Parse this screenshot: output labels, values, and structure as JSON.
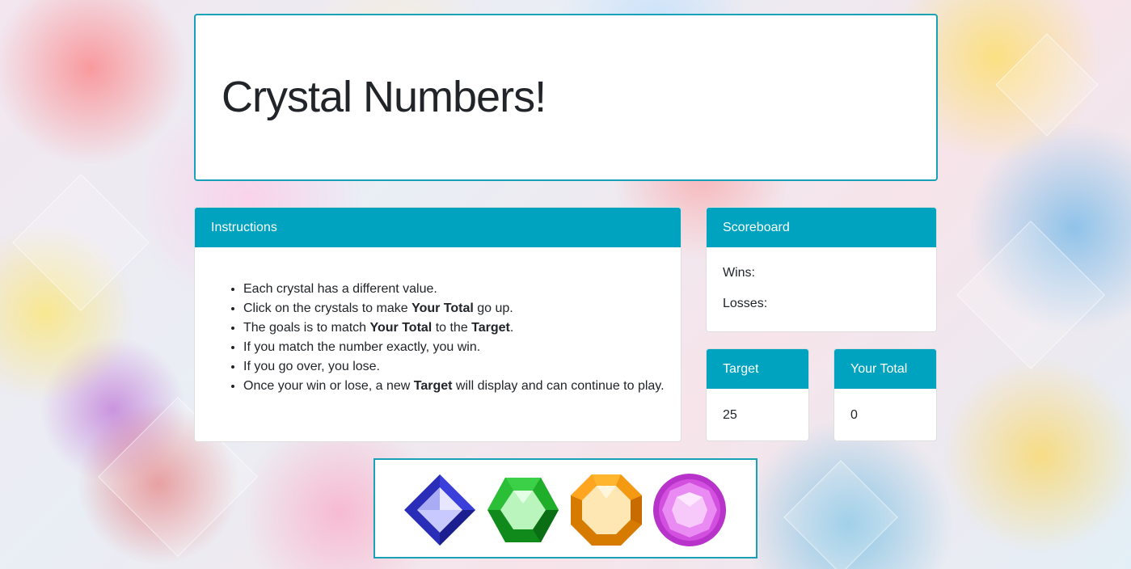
{
  "title": "Crystal Numbers!",
  "instructions": {
    "header": "Instructions",
    "items": [
      {
        "parts": [
          {
            "t": "Each crystal has a different value.",
            "b": false
          }
        ]
      },
      {
        "parts": [
          {
            "t": "Click on the crystals to make ",
            "b": false
          },
          {
            "t": "Your Total",
            "b": true
          },
          {
            "t": " go up.",
            "b": false
          }
        ]
      },
      {
        "parts": [
          {
            "t": "The goals is to match ",
            "b": false
          },
          {
            "t": "Your Total",
            "b": true
          },
          {
            "t": " to the ",
            "b": false
          },
          {
            "t": "Target",
            "b": true
          },
          {
            "t": ".",
            "b": false
          }
        ]
      },
      {
        "parts": [
          {
            "t": "If you match the number exactly, you win.",
            "b": false
          }
        ]
      },
      {
        "parts": [
          {
            "t": "If you go over, you lose.",
            "b": false
          }
        ]
      },
      {
        "parts": [
          {
            "t": "Once your win or lose, a new ",
            "b": false
          },
          {
            "t": "Target",
            "b": true
          },
          {
            "t": " will display and can continue to play.",
            "b": false
          }
        ]
      }
    ]
  },
  "scoreboard": {
    "header": "Scoreboard",
    "wins_label": "Wins:",
    "losses_label": "Losses:"
  },
  "target": {
    "header": "Target",
    "value": "25"
  },
  "your_total": {
    "header": "Your Total",
    "value": "0"
  },
  "crystals": [
    {
      "name": "blue-diamond-crystal",
      "color": "#3b3fd6"
    },
    {
      "name": "green-hexagon-crystal",
      "color": "#1fae2a"
    },
    {
      "name": "orange-octagon-crystal",
      "color": "#f0940f"
    },
    {
      "name": "pink-round-crystal",
      "color": "#d24fe0"
    }
  ],
  "colors": {
    "accent": "#00a3bf",
    "border": "#17a2b8"
  }
}
